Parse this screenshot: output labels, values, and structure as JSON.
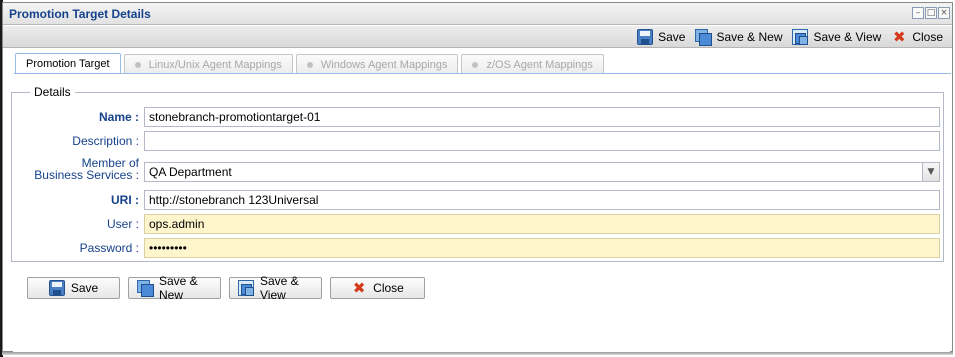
{
  "window": {
    "title": "Promotion Target Details",
    "controls": [
      "minimize-icon",
      "maximize-icon",
      "close-icon"
    ]
  },
  "toolbar": {
    "save_label": "Save",
    "save_new_label": "Save & New",
    "save_view_label": "Save & View",
    "close_label": "Close"
  },
  "tabs": [
    {
      "label": "Promotion Target",
      "active": true
    },
    {
      "label": "Linux/Unix Agent Mappings",
      "active": false
    },
    {
      "label": "Windows Agent Mappings",
      "active": false
    },
    {
      "label": "z/OS Agent Mappings",
      "active": false
    }
  ],
  "details": {
    "legend": "Details",
    "name_label": "Name :",
    "name_value": "stonebranch-promotiontarget-01",
    "description_label": "Description :",
    "description_value": "",
    "member_label_line1": "Member of",
    "member_label_line2": "Business Services :",
    "member_value": "QA Department",
    "uri_label": "URI :",
    "uri_value": "http://stonebranch 123Universal",
    "user_label": "User :",
    "user_value": "ops.admin",
    "password_label": "Password :",
    "password_value": "•••••••••"
  },
  "bottom_buttons": {
    "save_label": "Save",
    "save_new_label": "Save & New",
    "save_view_label": "Save & View",
    "close_label": "Close"
  },
  "colors": {
    "label_blue": "#15428b",
    "required_field": "#fff5cc",
    "close_red": "#d63a1c"
  }
}
